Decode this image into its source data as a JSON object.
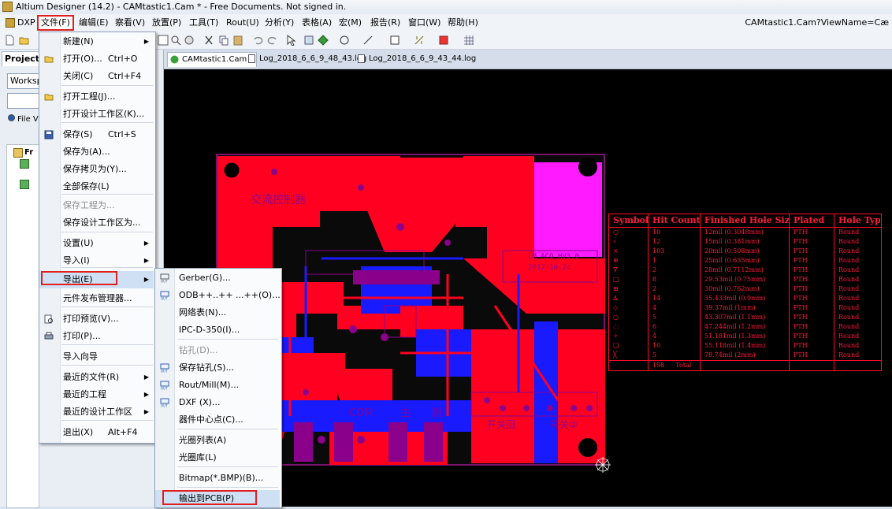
{
  "app": {
    "title": "Altium Designer (14.2) - CAMtastic1.Cam * - Free Documents. Not signed in.",
    "view_name": "CAMtastic1.Cam?ViewName=Cæ"
  },
  "menubar": {
    "items": [
      "DXP",
      "文件(F)",
      "编辑(E)",
      "察看(V)",
      "放置(P)",
      "工具(T)",
      "Rout(U)",
      "分析(Y)",
      "表格(A)",
      "宏(M)",
      "报告(R)",
      "窗口(W)",
      "帮助(H)"
    ]
  },
  "left_panel": {
    "tab": "Projects",
    "workspace": "Worksp",
    "file_view": "File Vi",
    "tree_root": "Fr"
  },
  "doc_tabs": [
    "CAMtastic1.Cam *",
    "Log_2018_6_6_9_48_43.log",
    "Log_2018_6_6_9_43_44.log"
  ],
  "file_menu": {
    "items": [
      {
        "label": "新建(N)",
        "shortcut": "",
        "submenu": true,
        "icon": "none",
        "disabled": false
      },
      {
        "label": "打开(O)...",
        "shortcut": "Ctrl+O",
        "submenu": false,
        "icon": "folder-open-icon",
        "disabled": false
      },
      {
        "label": "关闭(C)",
        "shortcut": "Ctrl+F4",
        "submenu": false,
        "icon": "none",
        "disabled": false
      },
      {
        "label": "打开工程(J)...",
        "shortcut": "",
        "submenu": false,
        "icon": "folder-open-icon",
        "disabled": false
      },
      {
        "label": "打开设计工作区(K)...",
        "shortcut": "",
        "submenu": false,
        "icon": "none",
        "disabled": false
      },
      {
        "label": "保存(S)",
        "shortcut": "Ctrl+S",
        "submenu": false,
        "icon": "save-icon",
        "disabled": false
      },
      {
        "label": "保存为(A)...",
        "shortcut": "",
        "submenu": false,
        "icon": "none",
        "disabled": false
      },
      {
        "label": "保存拷贝为(Y)...",
        "shortcut": "",
        "submenu": false,
        "icon": "none",
        "disabled": false
      },
      {
        "label": "全部保存(L)",
        "shortcut": "",
        "submenu": false,
        "icon": "none",
        "disabled": false
      },
      {
        "label": "保存工程为...",
        "shortcut": "",
        "submenu": false,
        "icon": "none",
        "disabled": true
      },
      {
        "label": "保存设计工作区为...",
        "shortcut": "",
        "submenu": false,
        "icon": "none",
        "disabled": false
      },
      {
        "label": "设置(U)",
        "shortcut": "",
        "submenu": true,
        "icon": "none",
        "disabled": false
      },
      {
        "label": "导入(I)",
        "shortcut": "",
        "submenu": true,
        "icon": "none",
        "disabled": false
      },
      {
        "label": "导出(E)",
        "shortcut": "",
        "submenu": true,
        "icon": "none",
        "disabled": false
      },
      {
        "label": "元件发布管理器...",
        "shortcut": "",
        "submenu": false,
        "icon": "none",
        "disabled": false
      },
      {
        "label": "打印预览(V)...",
        "shortcut": "",
        "submenu": false,
        "icon": "print-preview-icon",
        "disabled": false
      },
      {
        "label": "打印(P)...",
        "shortcut": "",
        "submenu": false,
        "icon": "printer-icon",
        "disabled": false
      },
      {
        "label": "导入向导",
        "shortcut": "",
        "submenu": false,
        "icon": "none",
        "disabled": false
      },
      {
        "label": "最近的文件(R)",
        "shortcut": "",
        "submenu": true,
        "icon": "none",
        "disabled": false
      },
      {
        "label": "最近的工程",
        "shortcut": "",
        "submenu": true,
        "icon": "none",
        "disabled": false
      },
      {
        "label": "最近的设计工作区",
        "shortcut": "",
        "submenu": true,
        "icon": "none",
        "disabled": false
      },
      {
        "label": "退出(X)",
        "shortcut": "Alt+F4",
        "submenu": false,
        "icon": "none",
        "disabled": false
      }
    ]
  },
  "export_menu": {
    "items": [
      {
        "label": "Gerber(G)...",
        "icon": "gerber-out-icon",
        "disabled": false
      },
      {
        "label": "ODB++..++ ...++(O)...",
        "icon": "odb-out-icon",
        "disabled": false
      },
      {
        "label": "网络表(N)...",
        "icon": "none",
        "disabled": false
      },
      {
        "label": "IPC-D-350(I)...",
        "icon": "none",
        "disabled": false
      },
      {
        "label": "钻孔(D)...",
        "icon": "none",
        "disabled": true
      },
      {
        "label": "保存钻孔(S)...",
        "icon": "drill-out-icon",
        "disabled": false
      },
      {
        "label": "Rout/Mill(M)...",
        "icon": "rout-out-icon",
        "disabled": false
      },
      {
        "label": "DXF (X)...",
        "icon": "dxf-out-icon",
        "disabled": false
      },
      {
        "label": "器件中心点(C)...",
        "icon": "none",
        "disabled": false
      },
      {
        "label": "光圈列表(A)",
        "icon": "none",
        "disabled": false
      },
      {
        "label": "光圈库(L)",
        "icon": "none",
        "disabled": false
      },
      {
        "label": "Bitmap(*.BMP)(B)...",
        "icon": "none",
        "disabled": false
      },
      {
        "label": "输出到PCB(P)",
        "icon": "none",
        "disabled": false
      }
    ]
  },
  "pcb": {
    "silk_labels": [
      "交流控制器",
      "COM",
      "主",
      "副",
      "LM_ACQ_HV3.0",
      "2017-10-24",
      "开关回",
      "开关②"
    ]
  },
  "drill_table": {
    "headers": [
      "Symbol",
      "Hit Count",
      "Finished Hole Size",
      "Plated",
      "Hole Type"
    ],
    "rows": [
      [
        "○",
        "10",
        "12mil (0.3048mm)",
        "PTH",
        "Round"
      ],
      [
        "∘",
        "12",
        "15mil (0.381mm)",
        "PTH",
        "Round"
      ],
      [
        "×",
        "103",
        "20mil (0.508mm)",
        "PTH",
        "Round"
      ],
      [
        "⊕",
        "1",
        "25mil (0.635mm)",
        "PTH",
        "Round"
      ],
      [
        "∇",
        "2",
        "28mil (0.7112mm)",
        "PTH",
        "Round"
      ],
      [
        "□",
        "8",
        "29.53mil (0.75mm)",
        "PTH",
        "Round"
      ],
      [
        "⊞",
        "2",
        "30mil (0.762mm)",
        "PTH",
        "Round"
      ],
      [
        "∆",
        "14",
        "35.433mil (0.9mm)",
        "PTH",
        "Round"
      ],
      [
        "◇",
        "4",
        "39.37mil (1mm)",
        "PTH",
        "Round"
      ],
      [
        "○",
        "5",
        "43.307mil (1.1mm)",
        "PTH",
        "Round"
      ],
      [
        "◌",
        "6",
        "47.244mil (1.2mm)",
        "PTH",
        "Round"
      ],
      [
        "✧",
        "4",
        "51.181mil (1.3mm)",
        "PTH",
        "Round"
      ],
      [
        "❑",
        "10",
        "55.118mil (1.4mm)",
        "PTH",
        "Round"
      ],
      [
        "╳",
        "5",
        "78.74mil (2mm)",
        "PTH",
        "Round"
      ]
    ],
    "total_count": "198",
    "total_label": "Total"
  },
  "colors": {
    "copper_top": "#ff0020",
    "copper_bottom": "#1a1aff",
    "silk": "#8b008b",
    "board": "#000000"
  }
}
